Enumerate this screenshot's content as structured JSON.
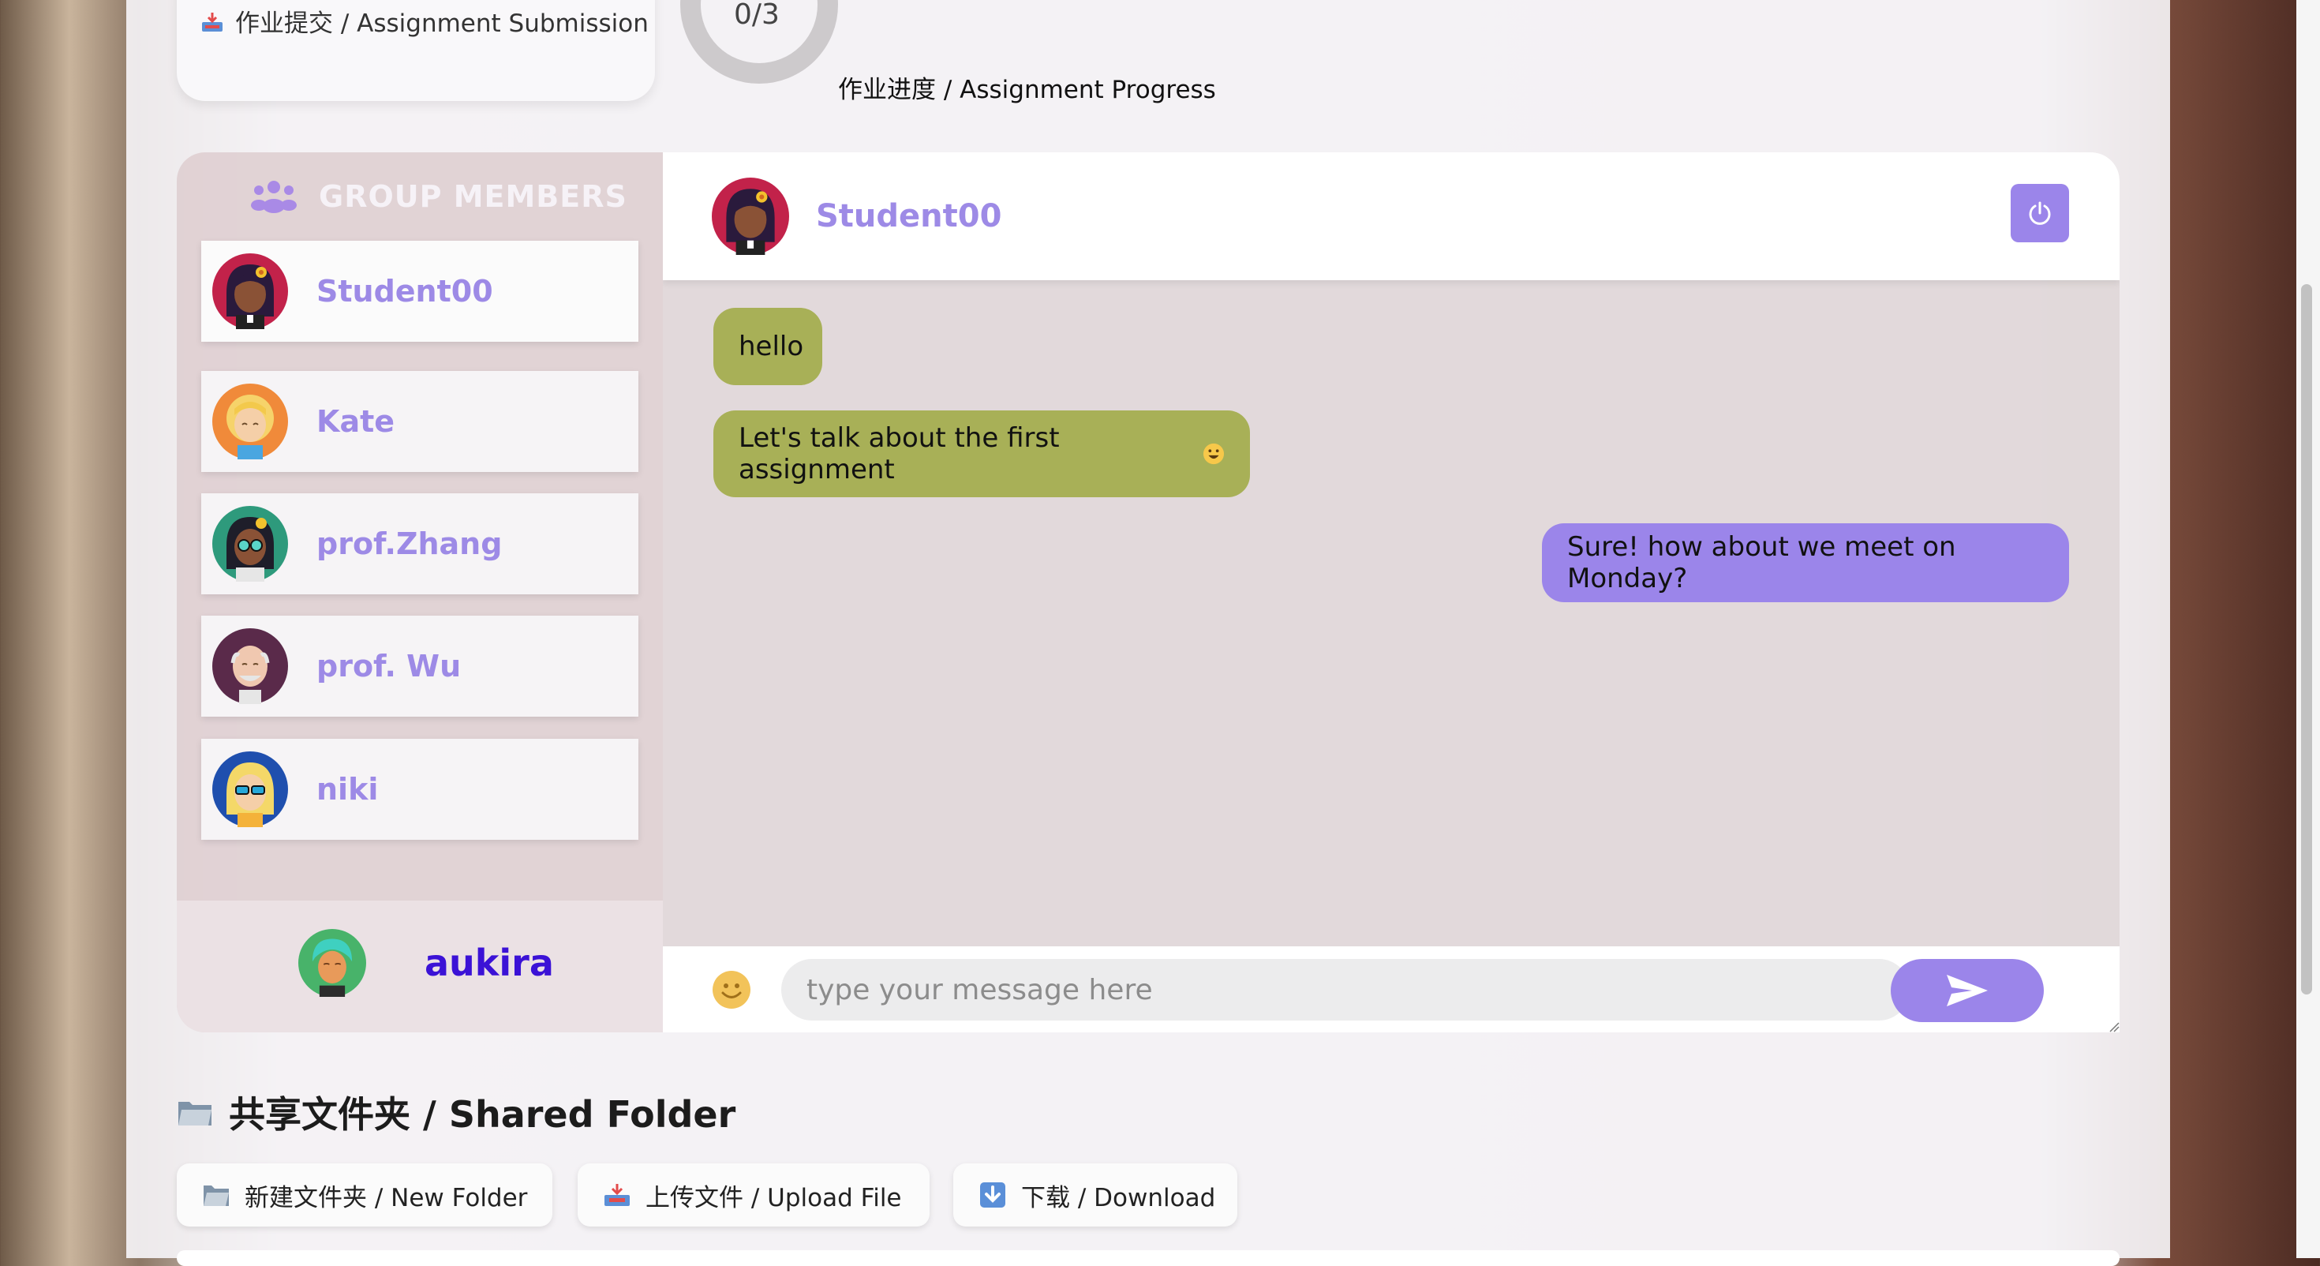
{
  "assignment": {
    "submission_label": "作业提交 / Assignment Submission",
    "progress_count": "0/3",
    "progress_fraction": 0,
    "progress_label": "作业进度 / Assignment Progress"
  },
  "members": {
    "title": "GROUP MEMBERS",
    "items": [
      {
        "name": "Student00",
        "avatar_icon": "avatar-woman-flower-icon"
      },
      {
        "name": "Kate",
        "avatar_icon": "avatar-blonde-woman-icon"
      },
      {
        "name": "prof.Zhang",
        "avatar_icon": "avatar-woman-glasses-icon"
      },
      {
        "name": "prof. Wu",
        "avatar_icon": "avatar-old-man-icon"
      },
      {
        "name": "niki",
        "avatar_icon": "avatar-woman-sunglasses-icon"
      }
    ],
    "current_user": {
      "name": "aukira",
      "avatar_icon": "avatar-teal-hair-icon"
    }
  },
  "chat": {
    "header_name": "Student00",
    "messages": [
      {
        "text": "hello",
        "direction": "incoming"
      },
      {
        "text": "Let's talk about the first assignment",
        "direction": "incoming",
        "emoji": "smile-emoji-icon"
      },
      {
        "text": "Sure! how about we meet on Monday?",
        "direction": "outgoing"
      }
    ],
    "input_placeholder": "type your message here"
  },
  "shared_folder": {
    "title": "共享文件夹 / Shared Folder",
    "buttons": [
      {
        "label": "新建文件夹 / New Folder",
        "icon": "folder-icon"
      },
      {
        "label": "上传文件 / Upload File",
        "icon": "inbox-tray-icon"
      },
      {
        "label": "下载 / Download",
        "icon": "down-arrow-icon"
      }
    ]
  },
  "colors": {
    "accent": "#9b85ea",
    "incoming_bubble": "#a8b057",
    "member_name": "#9d8ae6",
    "current_user_name": "#3b12d6"
  }
}
